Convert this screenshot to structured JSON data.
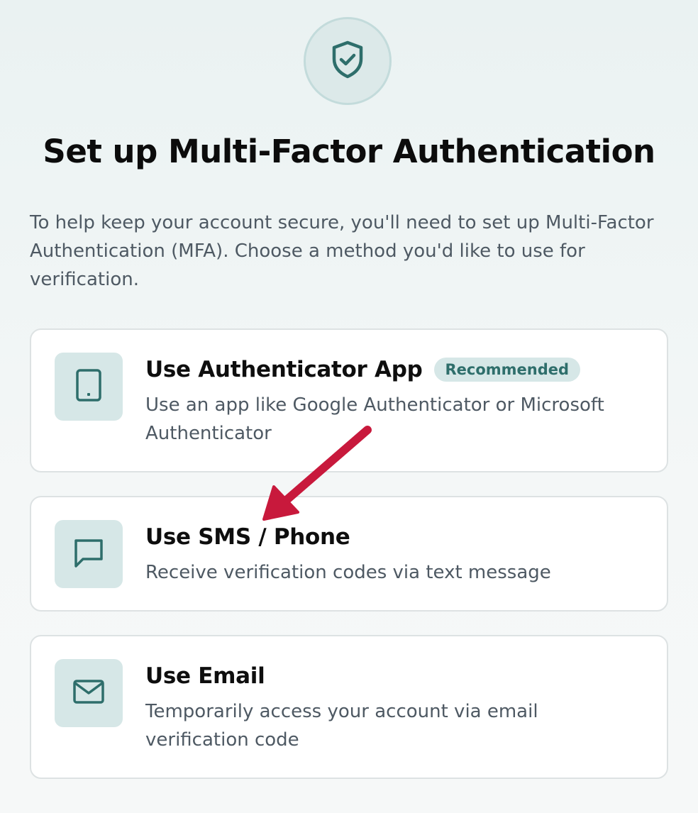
{
  "header": {
    "icon": "shield-check-icon",
    "title": "Set up Multi-Factor Authentication",
    "intro": "To help keep your account secure, you'll need to set up Multi-Factor Authentication (MFA). Choose a method you'd like to use for verification."
  },
  "options": [
    {
      "icon": "tablet-icon",
      "title": "Use Authenticator App",
      "badge": "Recommended",
      "description": "Use an app like Google Authenticator or Microsoft Authenticator"
    },
    {
      "icon": "message-icon",
      "title": "Use SMS / Phone",
      "description": "Receive verification codes via text message"
    },
    {
      "icon": "mail-icon",
      "title": "Use Email",
      "description": "Temporarily access your account via email verification code"
    }
  ],
  "annotation": {
    "icon": "arrow-icon",
    "color": "#c8193c"
  },
  "colors": {
    "accent": "#2e6e6b",
    "icon_bg": "#d6e7e7",
    "text_muted": "#4e5963"
  }
}
